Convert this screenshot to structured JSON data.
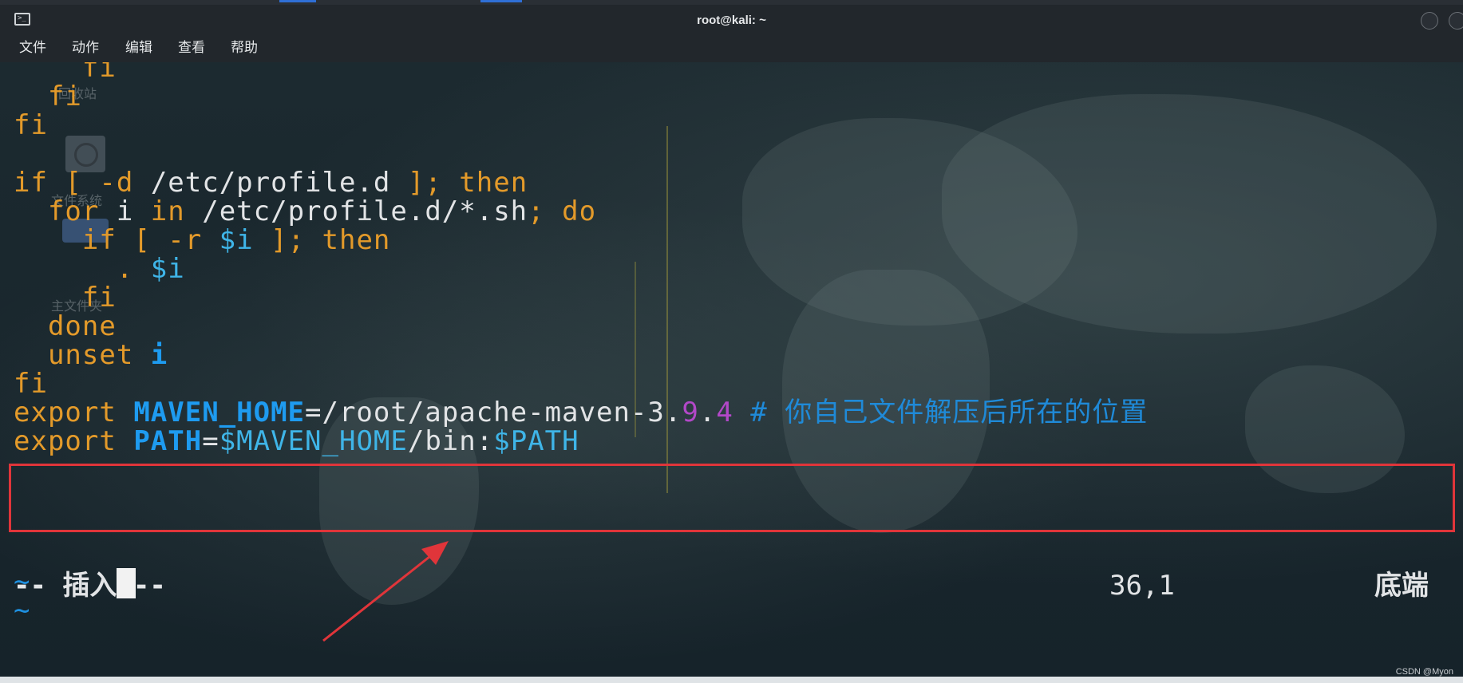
{
  "window": {
    "title": "root@kali: ~"
  },
  "menu": [
    {
      "label": "文件"
    },
    {
      "label": "动作"
    },
    {
      "label": "编辑"
    },
    {
      "label": "查看"
    },
    {
      "label": "帮助"
    }
  ],
  "desktop": {
    "labels": [
      "回收站",
      "文件系统",
      "主文件夹"
    ]
  },
  "editor": {
    "lines": [
      {
        "indent": "    ",
        "segments": [
          {
            "t": "fi",
            "c": "kw"
          }
        ]
      },
      {
        "indent": "  ",
        "segments": [
          {
            "t": "fi",
            "c": "kw"
          }
        ]
      },
      {
        "indent": "",
        "segments": [
          {
            "t": "fi",
            "c": "kw"
          }
        ]
      },
      {
        "indent": "",
        "segments": []
      },
      {
        "indent": "",
        "segments": [
          {
            "t": "if",
            "c": "kw"
          },
          {
            "t": " ",
            "c": "txt"
          },
          {
            "t": "[",
            "c": "kw"
          },
          {
            "t": " -d ",
            "c": "kw"
          },
          {
            "t": "/etc/profile.d",
            "c": "txt"
          },
          {
            "t": " ]; ",
            "c": "kw"
          },
          {
            "t": "then",
            "c": "kw"
          }
        ]
      },
      {
        "indent": "  ",
        "segments": [
          {
            "t": "for",
            "c": "kw"
          },
          {
            "t": " i ",
            "c": "txt"
          },
          {
            "t": "in",
            "c": "kw"
          },
          {
            "t": " /etc/profile.d/*.sh",
            "c": "txt"
          },
          {
            "t": "; ",
            "c": "kw"
          },
          {
            "t": "do",
            "c": "kw"
          }
        ]
      },
      {
        "indent": "    ",
        "segments": [
          {
            "t": "if",
            "c": "kw"
          },
          {
            "t": " [ -r ",
            "c": "kw"
          },
          {
            "t": "$i",
            "c": "var"
          },
          {
            "t": " ]; ",
            "c": "kw"
          },
          {
            "t": "then",
            "c": "kw"
          }
        ]
      },
      {
        "indent": "      ",
        "segments": [
          {
            "t": ". ",
            "c": "kw"
          },
          {
            "t": "$i",
            "c": "var"
          }
        ]
      },
      {
        "indent": "    ",
        "segments": [
          {
            "t": "fi",
            "c": "kw"
          }
        ]
      },
      {
        "indent": "  ",
        "segments": [
          {
            "t": "done",
            "c": "kw"
          }
        ]
      },
      {
        "indent": "  ",
        "segments": [
          {
            "t": "unset",
            "c": "kw"
          },
          {
            "t": " ",
            "c": "txt"
          },
          {
            "t": "i",
            "c": "bvar"
          }
        ]
      },
      {
        "indent": "",
        "segments": [
          {
            "t": "fi",
            "c": "kw"
          }
        ]
      },
      {
        "indent": "",
        "segments": [
          {
            "t": "export",
            "c": "kw"
          },
          {
            "t": " ",
            "c": "txt"
          },
          {
            "t": "MAVEN_HOME",
            "c": "bvar"
          },
          {
            "t": "=/root/apache-maven-3.",
            "c": "txt"
          },
          {
            "t": "9",
            "c": "num"
          },
          {
            "t": ".",
            "c": "txt"
          },
          {
            "t": "4",
            "c": "num"
          },
          {
            "t": " # 你自己文件解压后所在的位置",
            "c": "cmt"
          }
        ]
      },
      {
        "indent": "",
        "segments": [
          {
            "t": "export",
            "c": "kw"
          },
          {
            "t": " ",
            "c": "txt"
          },
          {
            "t": "PATH",
            "c": "bvar"
          },
          {
            "t": "=",
            "c": "txt"
          },
          {
            "t": "$MAVEN_HOME",
            "c": "var"
          },
          {
            "t": "/bin:",
            "c": "txt"
          },
          {
            "t": "$PATH",
            "c": "var"
          }
        ]
      }
    ],
    "tildes": [
      "~",
      "~"
    ]
  },
  "status": {
    "mode": "-- 插入 --",
    "position": "36,1",
    "scroll": "底端"
  },
  "watermark": "CSDN @Myon⁠⁠⁠",
  "colors": {
    "keyword": "#e39a2a",
    "variable": "#3fb5e8",
    "highlight_border": "#e0353a"
  }
}
